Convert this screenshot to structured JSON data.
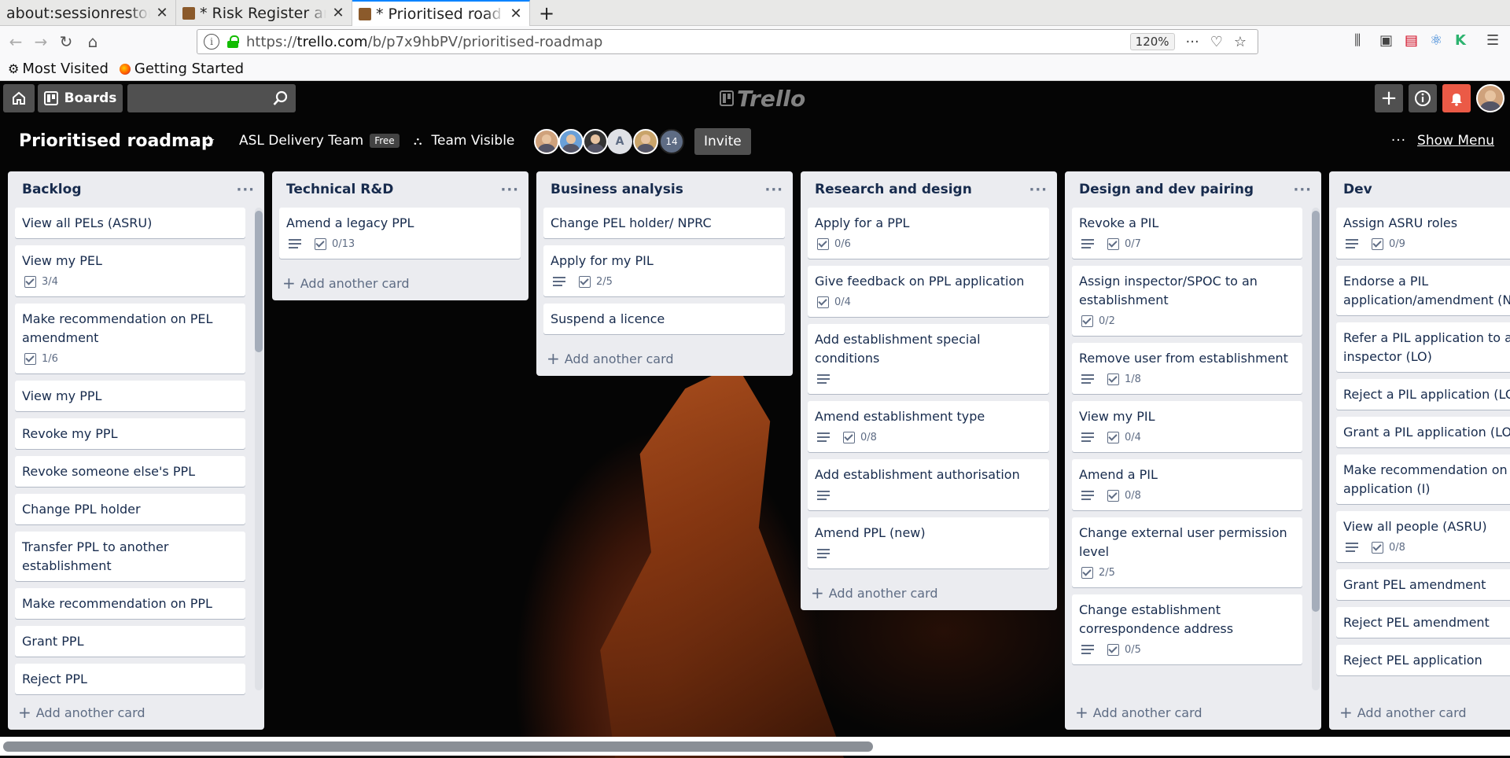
{
  "browser": {
    "tabs": [
      {
        "title": "about:sessionrestore",
        "icon": "none",
        "active": false
      },
      {
        "title": "* Risk Register an",
        "icon": "trello-favicon",
        "active": false
      },
      {
        "title": "* Prioritised road",
        "icon": "trello-favicon",
        "active": true
      }
    ],
    "new_tab_label": "+",
    "url_prefix": "https://",
    "url_host": "trello.com",
    "url_path": "/b/p7x9hbPV/prioritised-roadmap",
    "zoom": "120%",
    "bookmarks": [
      {
        "label": "Most Visited",
        "icon": "gear-icon"
      },
      {
        "label": "Getting Started",
        "icon": "firefox-icon"
      }
    ]
  },
  "header": {
    "boards_label": "Boards",
    "search_placeholder": "",
    "logo_text": "Trello"
  },
  "board": {
    "title": "Prioritised roadmap",
    "team": "ASL Delivery Team",
    "plan_badge": "Free",
    "visibility": "Team Visible",
    "member_initial": "A",
    "member_count": "14",
    "invite_label": "Invite",
    "show_menu_label": "Show Menu",
    "add_card_label": "Add another card"
  },
  "lists": [
    {
      "title": "Backlog",
      "cards": [
        {
          "title": "View all PELs (ASRU)",
          "desc": false,
          "checklist": null
        },
        {
          "title": "View my PEL",
          "desc": false,
          "checklist": "3/4"
        },
        {
          "title": "Make recommendation on PEL amendment",
          "desc": false,
          "checklist": "1/6"
        },
        {
          "title": "View my PPL",
          "desc": false,
          "checklist": null
        },
        {
          "title": "Revoke my PPL",
          "desc": false,
          "checklist": null
        },
        {
          "title": "Revoke someone else's PPL",
          "desc": false,
          "checklist": null
        },
        {
          "title": "Change PPL holder",
          "desc": false,
          "checklist": null
        },
        {
          "title": "Transfer PPL to another establishment",
          "desc": false,
          "checklist": null
        },
        {
          "title": "Make recommendation on PPL",
          "desc": false,
          "checklist": null
        },
        {
          "title": "Grant PPL",
          "desc": false,
          "checklist": null
        },
        {
          "title": "Reject PPL",
          "desc": false,
          "checklist": null
        }
      ]
    },
    {
      "title": "Technical R&D",
      "cards": [
        {
          "title": "Amend a legacy PPL",
          "desc": true,
          "checklist": "0/13"
        }
      ]
    },
    {
      "title": "Business analysis",
      "cards": [
        {
          "title": "Change PEL holder/ NPRC",
          "desc": false,
          "checklist": null
        },
        {
          "title": "Apply for my PIL",
          "desc": true,
          "checklist": "2/5"
        },
        {
          "title": "Suspend a licence",
          "desc": false,
          "checklist": null
        }
      ]
    },
    {
      "title": "Research and design",
      "cards": [
        {
          "title": "Apply for a PPL",
          "desc": false,
          "checklist": "0/6"
        },
        {
          "title": "Give feedback on PPL application",
          "desc": false,
          "checklist": "0/4"
        },
        {
          "title": "Add establishment special conditions",
          "desc": true,
          "checklist": null
        },
        {
          "title": "Amend establishment type",
          "desc": true,
          "checklist": "0/8"
        },
        {
          "title": "Add establishment authorisation",
          "desc": true,
          "checklist": null
        },
        {
          "title": "Amend PPL (new)",
          "desc": true,
          "checklist": null
        }
      ]
    },
    {
      "title": "Design and dev pairing",
      "cards": [
        {
          "title": "Revoke a PIL",
          "desc": true,
          "checklist": "0/7"
        },
        {
          "title": "Assign inspector/SPOC to an establishment",
          "desc": false,
          "checklist": "0/2"
        },
        {
          "title": "Remove user from establishment",
          "desc": true,
          "checklist": "1/8"
        },
        {
          "title": "View my PIL",
          "desc": true,
          "checklist": "0/4"
        },
        {
          "title": "Amend a PIL",
          "desc": true,
          "checklist": "0/8"
        },
        {
          "title": "Change external user permission level",
          "desc": false,
          "checklist": "2/5"
        },
        {
          "title": "Change establishment correspondence address",
          "desc": true,
          "checklist": "0/5"
        }
      ]
    },
    {
      "title": "Dev",
      "cards": [
        {
          "title": "Assign ASRU roles",
          "desc": true,
          "checklist": "0/9"
        },
        {
          "title": "Endorse a PIL application/amendment (NTCO)",
          "desc": false,
          "checklist": null
        },
        {
          "title": "Refer a PIL application to an inspector (LO)",
          "desc": false,
          "checklist": null
        },
        {
          "title": "Reject a PIL application (LO)",
          "desc": false,
          "checklist": null
        },
        {
          "title": "Grant a PIL application (LO)",
          "desc": false,
          "checklist": null
        },
        {
          "title": "Make recommendation on re PIL application (I)",
          "desc": false,
          "checklist": null
        },
        {
          "title": "View all people (ASRU)",
          "desc": true,
          "checklist": "0/8"
        },
        {
          "title": "Grant PEL amendment",
          "desc": false,
          "checklist": null
        },
        {
          "title": "Reject PEL amendment",
          "desc": false,
          "checklist": null
        },
        {
          "title": "Reject PEL application",
          "desc": false,
          "checklist": null
        }
      ]
    }
  ]
}
